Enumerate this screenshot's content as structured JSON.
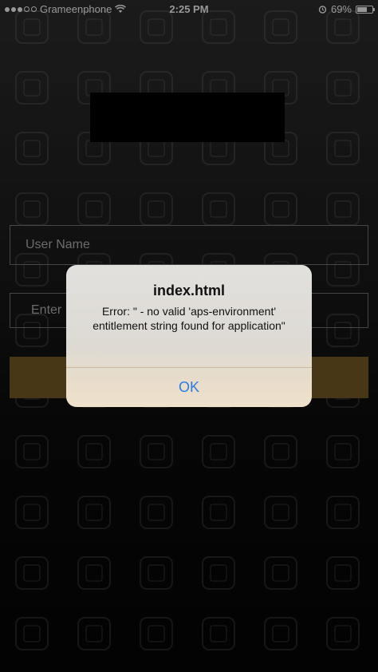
{
  "status_bar": {
    "carrier": "Grameenphone",
    "time": "2:25 PM",
    "battery_percent": "69%",
    "battery_level": 0.69,
    "icons": [
      "signal-icon",
      "wifi-icon",
      "alarm-icon",
      "battery-icon"
    ]
  },
  "login_form": {
    "username_placeholder": "User Name",
    "password_placeholder_partial": "Enter",
    "button_color": "#6f5523"
  },
  "alert": {
    "title": "index.html",
    "message": "Error: \" - no valid 'aps-environment' entitlement string found for application\"",
    "ok_label": "OK",
    "ok_color": "#2a7be6"
  }
}
